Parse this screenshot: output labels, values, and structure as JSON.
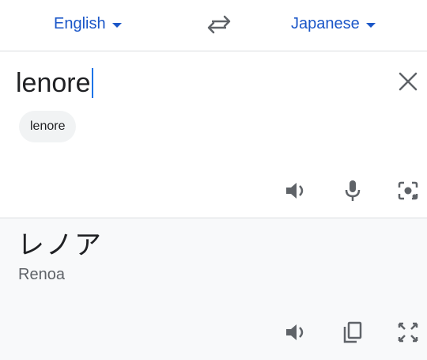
{
  "lang_bar": {
    "source_lang": "English",
    "target_lang": "Japanese",
    "swap_icon": "swap-arrows-icon"
  },
  "input": {
    "text": "lenore",
    "suggestion_chip": "lenore",
    "close_icon": "close-icon",
    "actions": [
      "speaker-icon",
      "microphone-icon",
      "camera-icon"
    ]
  },
  "output": {
    "text": "レノア",
    "transliteration": "Renoa",
    "actions": [
      "speaker-icon",
      "copy-icon",
      "expand-icon"
    ]
  },
  "colors": {
    "accent": "#1a56c8",
    "cursor": "#1a73e8",
    "icon": "#5f6368",
    "output_bg": "#f8f9fa",
    "chip_bg": "#f1f3f4"
  }
}
